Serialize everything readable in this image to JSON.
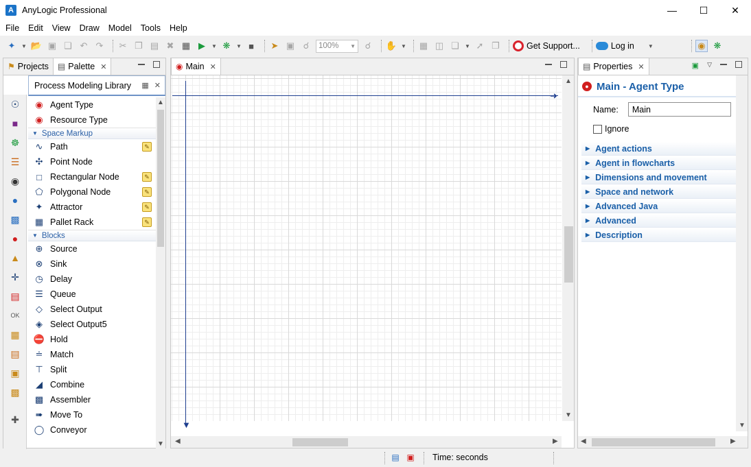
{
  "window": {
    "title": "AnyLogic Professional"
  },
  "menu": [
    "File",
    "Edit",
    "View",
    "Draw",
    "Model",
    "Tools",
    "Help"
  ],
  "toolbar": {
    "zoom": "100%",
    "support_label": "Get Support...",
    "login_label": "Log in"
  },
  "left_pane": {
    "tabs": [
      {
        "label": "Projects"
      },
      {
        "label": "Palette"
      }
    ]
  },
  "palette": {
    "library": "Process Modeling Library",
    "top_items": [
      {
        "label": "Agent Type",
        "icon": "agent-type-icon"
      },
      {
        "label": "Resource Type",
        "icon": "resource-type-icon"
      }
    ],
    "space_markup": {
      "label": "Space Markup",
      "items": [
        {
          "label": "Path",
          "icon": "path-icon",
          "editable": true
        },
        {
          "label": "Point Node",
          "icon": "point-node-icon",
          "editable": false
        },
        {
          "label": "Rectangular Node",
          "icon": "rectangular-node-icon",
          "editable": true
        },
        {
          "label": "Polygonal Node",
          "icon": "polygonal-node-icon",
          "editable": true
        },
        {
          "label": "Attractor",
          "icon": "attractor-icon",
          "editable": true
        },
        {
          "label": "Pallet Rack",
          "icon": "pallet-rack-icon",
          "editable": true
        }
      ]
    },
    "blocks": {
      "label": "Blocks",
      "items": [
        {
          "label": "Source",
          "icon": "source-icon"
        },
        {
          "label": "Sink",
          "icon": "sink-icon"
        },
        {
          "label": "Delay",
          "icon": "delay-icon"
        },
        {
          "label": "Queue",
          "icon": "queue-icon"
        },
        {
          "label": "Select Output",
          "icon": "select-output-icon"
        },
        {
          "label": "Select Output5",
          "icon": "select-output5-icon"
        },
        {
          "label": "Hold",
          "icon": "hold-icon"
        },
        {
          "label": "Match",
          "icon": "match-icon"
        },
        {
          "label": "Split",
          "icon": "split-icon"
        },
        {
          "label": "Combine",
          "icon": "combine-icon"
        },
        {
          "label": "Assembler",
          "icon": "assembler-icon"
        },
        {
          "label": "Move To",
          "icon": "move-to-icon"
        },
        {
          "label": "Conveyor",
          "icon": "conveyor-icon"
        }
      ]
    }
  },
  "editor": {
    "tab_label": "Main"
  },
  "properties": {
    "tab_label": "Properties",
    "title": "Main - Agent Type",
    "name_label": "Name:",
    "name_value": "Main",
    "ignore_label": "Ignore",
    "sections": [
      "Agent actions",
      "Agent in flowcharts",
      "Dimensions and movement",
      "Space and network",
      "Advanced Java",
      "Advanced",
      "Description"
    ]
  },
  "status": {
    "time_units": "Time: seconds"
  },
  "colors": {
    "accent_blue": "#1a5fa8",
    "agent_red": "#d11e1e",
    "axis_blue": "#1e3e8f"
  }
}
